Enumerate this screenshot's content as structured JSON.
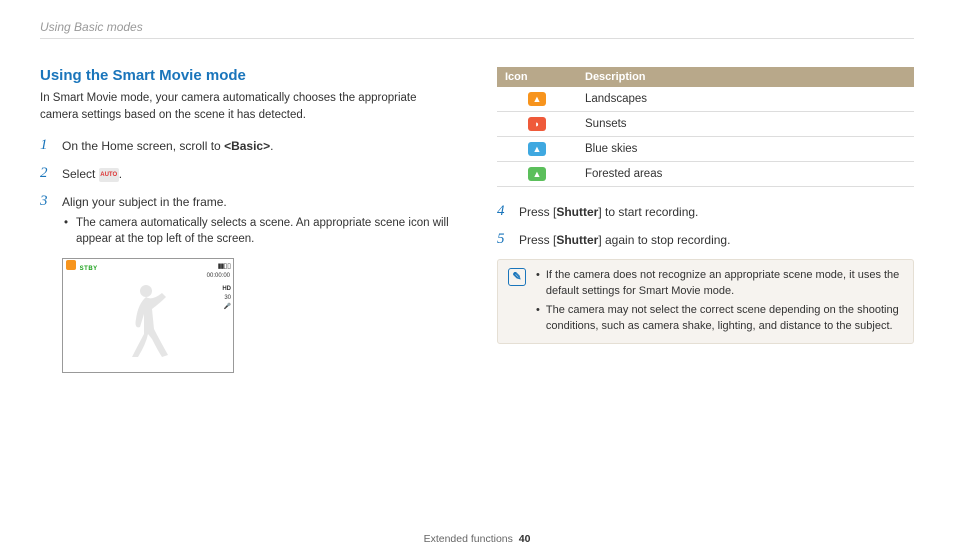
{
  "breadcrumb": "Using Basic modes",
  "heading": "Using the Smart Movie mode",
  "intro": "In Smart Movie mode, your camera automatically chooses the appropriate camera settings based on the scene it has detected.",
  "steps": {
    "s1_pre": "On the Home screen, scroll to ",
    "s1_bold": "<Basic>",
    "s1_post": ".",
    "s2_pre": "Select ",
    "s2_icon_label": "AUTO",
    "s2_post": ".",
    "s3": "Align your subject in the frame.",
    "s3_sub": "The camera automatically selects a scene. An appropriate scene icon will appear at the top left of the screen.",
    "s4_pre": "Press [",
    "s4_bold": "Shutter",
    "s4_post": "] to start recording.",
    "s5_pre": "Press [",
    "s5_bold": "Shutter",
    "s5_post": "] again to stop recording."
  },
  "screenshot": {
    "stby": "STBY",
    "time": "00:00:00",
    "hd": "HD",
    "fps": "30"
  },
  "table": {
    "h_icon": "Icon",
    "h_desc": "Description",
    "rows": [
      {
        "desc": "Landscapes",
        "color": "si-orange",
        "glyph": "▲"
      },
      {
        "desc": "Sunsets",
        "color": "si-red",
        "glyph": "◗"
      },
      {
        "desc": "Blue skies",
        "color": "si-blue",
        "glyph": "▲"
      },
      {
        "desc": "Forested areas",
        "color": "si-green",
        "glyph": "▲"
      }
    ]
  },
  "notes": {
    "n1": "If the camera does not recognize an appropriate scene mode, it uses the default settings for Smart Movie mode.",
    "n2": "The camera may not select the correct scene depending on the shooting conditions, such as camera shake, lighting, and distance to the subject."
  },
  "footer_label": "Extended functions",
  "footer_page": "40"
}
